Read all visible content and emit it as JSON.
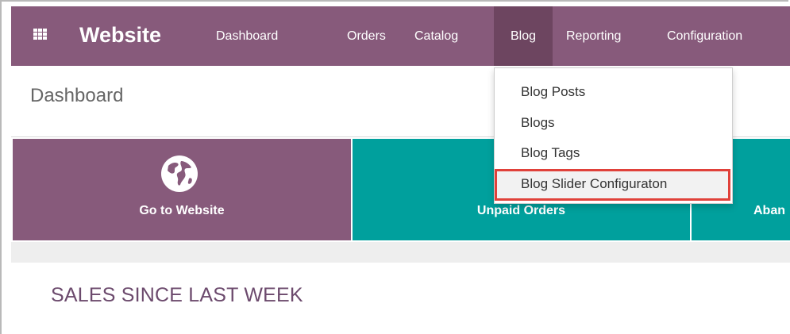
{
  "navbar": {
    "brand": "Website",
    "menu": [
      "Dashboard",
      "Orders",
      "Catalog",
      "Blog",
      "Reporting",
      "Configuration"
    ],
    "active": "Blog",
    "color": "#875a7b",
    "active_color": "#6d4560"
  },
  "control_panel": {
    "title": "Dashboard"
  },
  "tiles": {
    "go_to_website": "Go to Website",
    "unpaid_orders": "Unpaid Orders",
    "abandoned_partial": "Aban"
  },
  "section": {
    "title": "SALES SINCE LAST WEEK"
  },
  "dropdown": {
    "items": [
      "Blog Posts",
      "Blogs",
      "Blog Tags",
      "Blog Slider Configuraton"
    ],
    "highlighted": "Blog Slider Configuraton",
    "highlight_color": "#e0413a"
  },
  "icons": {
    "apps": "apps-grid-icon",
    "globe": "globe-icon"
  }
}
